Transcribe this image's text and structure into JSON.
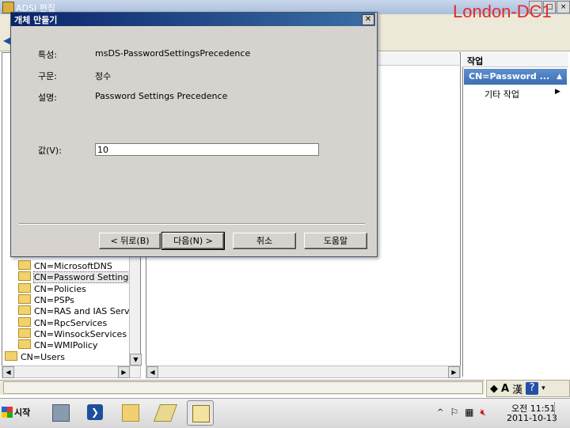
{
  "window": {
    "title": "ADSI 편집"
  },
  "watermark": "London-DC1",
  "tree": {
    "items": [
      {
        "label": "CN=MicrosoftDNS"
      },
      {
        "label": "CN=Password Settings C",
        "selected": true
      },
      {
        "label": "CN=Policies"
      },
      {
        "label": "CN=PSPs"
      },
      {
        "label": "CN=RAS and IAS Server"
      },
      {
        "label": "CN=RpcServices"
      },
      {
        "label": "CN=WinsockServices"
      },
      {
        "label": "CN=WMIPolicy"
      }
    ],
    "root_item": "CN=Users"
  },
  "actions": {
    "title": "작업",
    "selected": "CN=Password ...",
    "more": "기타 작업"
  },
  "dialog": {
    "title": "개체 만들기",
    "attribute_label": "특성:",
    "attribute_value": "msDS-PasswordSettingsPrecedence",
    "syntax_label": "구문:",
    "syntax_value": "정수",
    "description_label": "설명:",
    "description_value": "Password Settings Precedence",
    "value_label": "값(V):",
    "value_input": "10",
    "buttons": {
      "back": "< 뒤로(B)",
      "next": "다음(N) >",
      "cancel": "취소",
      "help": "도움말"
    }
  },
  "langbar": {
    "mode": "A",
    "hanja": "漢"
  },
  "taskbar": {
    "start_label": "시작",
    "clock_time": "오전 11:51",
    "clock_date": "2011-10-13"
  }
}
